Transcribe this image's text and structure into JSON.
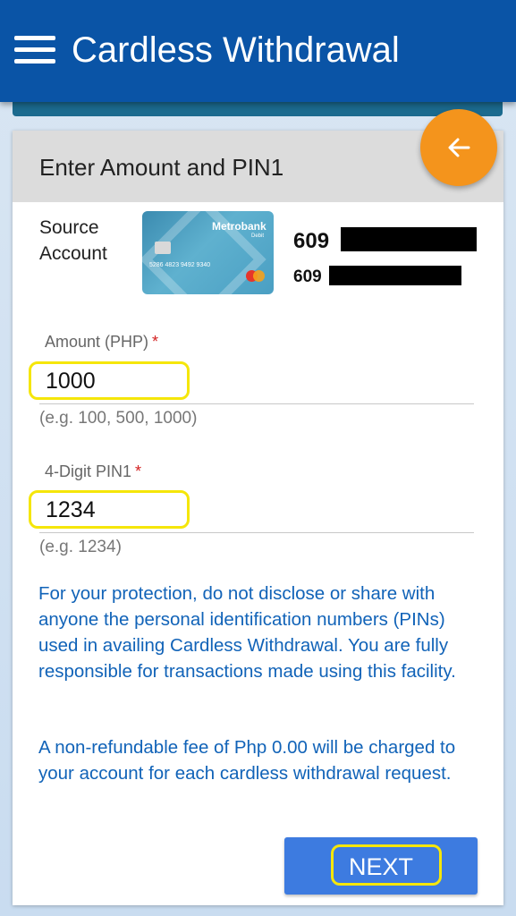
{
  "appbar": {
    "title": "Cardless Withdrawal",
    "menu_icon": "hamburger-menu-icon"
  },
  "fab": {
    "icon": "arrow-left-icon",
    "color": "#f4941c"
  },
  "form": {
    "title": "Enter Amount and PIN1",
    "source_account_label": "Source Account",
    "card_bank_name": "Metrobank",
    "card_type": "Debit",
    "card_number": "5286 4823 9492 9340",
    "card_holder": "JUAN DELA CRUZ",
    "account_number_prefix": "609",
    "account_number_2_prefix": "609",
    "amount": {
      "label": "Amount (PHP)",
      "required_mark": "*",
      "value": "1000",
      "hint": "(e.g. 100, 500, 1000)"
    },
    "pin": {
      "label": "4-Digit PIN1",
      "required_mark": "*",
      "value": "1234",
      "hint": "(e.g. 1234)"
    },
    "notice_protection": "For your protection, do not disclose or share with anyone the personal identification numbers (PINs) used in availing Cardless Withdrawal. You are fully responsible for transactions made using this facility.",
    "notice_fee": "A non-refundable fee of Php 0.00 will be charged to your account for each cardless withdrawal request.",
    "next_label": "NEXT"
  },
  "colors": {
    "appbar": "#0a54a6",
    "accent_button": "#3d7be0",
    "notice_text": "#1163b8",
    "highlight": "#f5e60a"
  }
}
